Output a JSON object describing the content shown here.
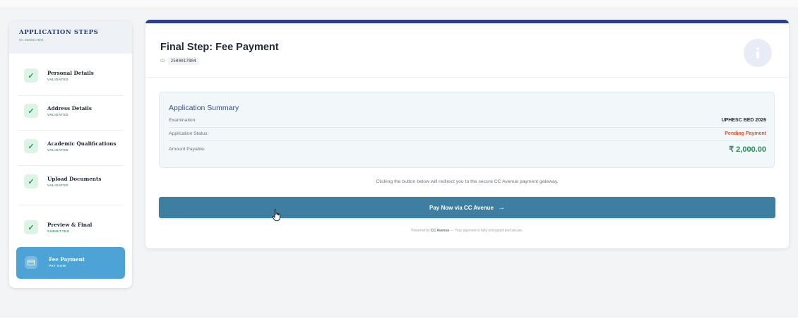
{
  "sidebar": {
    "title": "APPLICATION STEPS",
    "app_id": "ID: 2500017804",
    "steps": [
      {
        "name": "Personal Details",
        "status": "VALIDATED",
        "icon": "check-icon"
      },
      {
        "name": "Address Details",
        "status": "VALIDATED",
        "icon": "check-icon"
      },
      {
        "name": "Academic Qualifications",
        "status": "VALIDATED",
        "icon": "check-icon"
      },
      {
        "name": "Upload Documents",
        "status": "VALIDATED",
        "icon": "check-icon"
      },
      {
        "name": "Preview & Final",
        "status": "SUBMITTED",
        "icon": "check-icon"
      },
      {
        "name": "Fee Payment",
        "status": "PAY NOW",
        "icon": "card-icon",
        "active": true
      }
    ]
  },
  "header": {
    "title": "Final Step: Fee Payment",
    "id_label": "ID:",
    "id_value": "2500017804",
    "icon": "info-icon"
  },
  "summary": {
    "title": "Application Summary",
    "rows": [
      {
        "label": "Examination:",
        "value": "UPHESC BED 2026"
      },
      {
        "label": "Application Status:",
        "value": "Pending Payment"
      },
      {
        "label": "Amount Payable:",
        "value": "₹ 2,000.00"
      }
    ]
  },
  "notice": "Clicking the button below will redirect you to the secure CC Avenue payment gateway.",
  "pay_button": {
    "label": "Pay Now via CC Avenue",
    "arrow": "→"
  },
  "footer": {
    "prefix": "Powered by ",
    "brand": "CC Avenue",
    "suffix": " — Your payment is fully encrypted and secure."
  },
  "colors": {
    "accent": "#3e7fa1",
    "active_step": "#4ea3d6",
    "validated": "#3aa574",
    "pending": "#d4552b",
    "amount": "#2e8b57",
    "header_bar": "#2f3f8f"
  }
}
